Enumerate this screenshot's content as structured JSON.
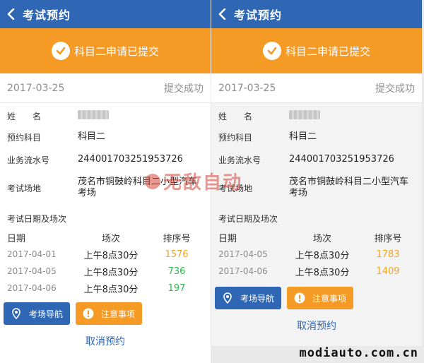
{
  "header": {
    "title": "考试预约"
  },
  "banner": {
    "text": "科目二申请已提交"
  },
  "record": {
    "date": "2017-03-25",
    "status": "提交成功"
  },
  "labels": {
    "name": "姓　　名",
    "subject": "预约科目",
    "serial": "业务流水号",
    "site": "考试场地",
    "schedule": "考试日期及场次"
  },
  "values": {
    "subject": "科目二",
    "serial": "244001703251953726",
    "site_line1": "茂名市铜鼓岭科目二小型汽车",
    "site_line2": "考场"
  },
  "table": {
    "headers": [
      "日期",
      "场次",
      "排序号"
    ],
    "left_rows": [
      {
        "date": "2017-04-01",
        "session": "上午8点30分",
        "rank": "1576",
        "rank_color": "#f5a623"
      },
      {
        "date": "2017-04-05",
        "session": "上午8点30分",
        "rank": "736",
        "rank_color": "#2db84d"
      },
      {
        "date": "2017-04-06",
        "session": "上午8点30分",
        "rank": "197",
        "rank_color": "#2db84d"
      }
    ],
    "right_rows": [
      {
        "date": "2017-04-05",
        "session": "上午8点30分",
        "rank": "1783",
        "rank_color": "#f5a623"
      },
      {
        "date": "2017-04-06",
        "session": "上午8点30分",
        "rank": "1409",
        "rank_color": "#f5a623"
      }
    ]
  },
  "buttons": {
    "nav": "考场导航",
    "notice": "注意事项",
    "cancel": "取消预约"
  },
  "icons": {
    "back": "chevron-left-icon",
    "check": "check-circle-icon",
    "location": "location-pin-icon",
    "warning": "exclamation-icon"
  },
  "watermark": {
    "text": "无敌自动"
  },
  "site": {
    "text": "modiauto.com.cn"
  },
  "colors": {
    "primary": "#2f67b5",
    "accent": "#f59a24"
  }
}
